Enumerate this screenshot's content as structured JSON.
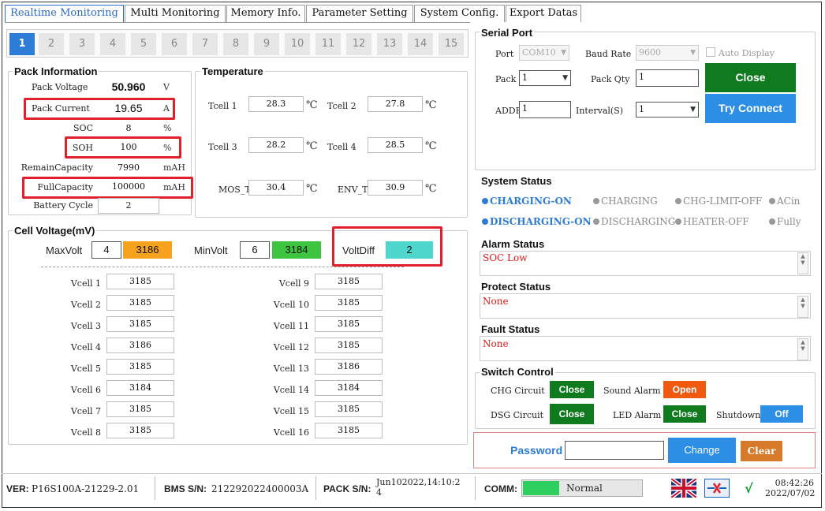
{
  "tabs": [
    "Realtime Monitoring",
    "Multi Monitoring",
    "Memory Info.",
    "Parameter Setting",
    "System Config.",
    "Export Datas"
  ],
  "pack_buttons": [
    "1",
    "2",
    "3",
    "4",
    "5",
    "6",
    "7",
    "8",
    "9",
    "10",
    "11",
    "12",
    "13",
    "14",
    "15"
  ],
  "pack_info": {
    "title": "Pack Information",
    "pack_voltage_label": "Pack Voltage",
    "pack_voltage": "50.960",
    "pack_voltage_unit": "V",
    "pack_current_label": "Pack Current",
    "pack_current": "19.65",
    "pack_current_unit": "A",
    "soc_label": "SOC",
    "soc": "8",
    "soc_unit": "%",
    "soh_label": "SOH",
    "soh": "100",
    "soh_unit": "%",
    "remain_label": "RemainCapacity",
    "remain": "7990",
    "remain_unit": "mAH",
    "full_label": "FullCapacity",
    "full": "100000",
    "full_unit": "mAH",
    "cycle_label": "Battery Cycle",
    "cycle": "2"
  },
  "temperature": {
    "title": "Temperature",
    "unit": "℃",
    "tcell1_label": "Tcell 1",
    "tcell1": "28.3",
    "tcell2_label": "Tcell 2",
    "tcell2": "27.8",
    "tcell3_label": "Tcell 3",
    "tcell3": "28.2",
    "tcell4_label": "Tcell 4",
    "tcell4": "28.5",
    "mos_label": "MOS_T",
    "mos": "30.4",
    "env_label": "ENV_T",
    "env": "30.9"
  },
  "cell_voltage": {
    "title": "Cell Voltage(mV)",
    "max_label": "MaxVolt",
    "max_index": "4",
    "max_value": "3186",
    "min_label": "MinVolt",
    "min_index": "6",
    "min_value": "3184",
    "diff_label": "VoltDiff",
    "diff_value": "2",
    "cells": [
      {
        "label": "Vcell 1",
        "value": "3185"
      },
      {
        "label": "Vcell 2",
        "value": "3185"
      },
      {
        "label": "Vcell 3",
        "value": "3185"
      },
      {
        "label": "Vcell 4",
        "value": "3186"
      },
      {
        "label": "Vcell 5",
        "value": "3185"
      },
      {
        "label": "Vcell 6",
        "value": "3184"
      },
      {
        "label": "Vcell 7",
        "value": "3185"
      },
      {
        "label": "Vcell 8",
        "value": "3185"
      },
      {
        "label": "Vcell 9",
        "value": "3185"
      },
      {
        "label": "Vcell 10",
        "value": "3185"
      },
      {
        "label": "Vcell 11",
        "value": "3185"
      },
      {
        "label": "Vcell 12",
        "value": "3185"
      },
      {
        "label": "Vcell 13",
        "value": "3186"
      },
      {
        "label": "Vcell 14",
        "value": "3184"
      },
      {
        "label": "Vcell 15",
        "value": "3185"
      },
      {
        "label": "Vcell 16",
        "value": "3185"
      }
    ]
  },
  "serial": {
    "title": "Serial Port",
    "port_label": "Port",
    "port": "COM10",
    "baud_label": "Baud Rate",
    "baud": "9600",
    "auto_display": "Auto Display",
    "pack_label": "Pack",
    "pack": "1",
    "packqty_label": "Pack Qty",
    "packqty": "1",
    "addr_label": "ADDR",
    "addr": "1",
    "interval_label": "Interval(S)",
    "interval": "1",
    "close_btn": "Close",
    "try_btn": "Try Connect"
  },
  "system_status": {
    "title": "System Status",
    "items": [
      "CHARGING-ON",
      "CHARGING",
      "CHG-LIMIT-OFF",
      "ACin",
      "DISCHARGING-ON",
      "DISCHARGING",
      "HEATER-OFF",
      "Fully"
    ]
  },
  "alarm": {
    "title": "Alarm Status",
    "text": "SOC Low"
  },
  "protect": {
    "title": "Protect Status",
    "text": "None"
  },
  "fault": {
    "title": "Fault Status",
    "text": "None"
  },
  "switch": {
    "title": "Switch Control",
    "chg_label": "CHG Circuit",
    "chg_btn": "Close",
    "sound_label": "Sound Alarm",
    "sound_btn": "Open",
    "dsg_label": "DSG Circuit",
    "dsg_btn": "Close",
    "led_label": "LED Alarm",
    "led_btn": "Close",
    "shutdown_label": "Shutdown",
    "shutdown_btn": "Off"
  },
  "password": {
    "label": "Password",
    "value": "",
    "change_btn": "Change",
    "clear_btn": "Clear"
  },
  "statusbar": {
    "ver_label": "VER:",
    "ver": "P16S100A-21229-2.01",
    "bms_label": "BMS S/N:",
    "bms": "212292022400003A",
    "pack_sn_label": "PACK S/N:",
    "pack_sn_line1": "Jun102022,14:10:2",
    "pack_sn_line2": "4",
    "comm_label": "COMM:",
    "comm": "Normal",
    "check": "√",
    "time": "08:42:26",
    "date": "2022/07/02"
  },
  "colors": {
    "accent_blue": "#2d7cd6",
    "green": "#0f7a1e",
    "orange": "#f08a1c",
    "highlight_red": "#e0202a",
    "max_orange": "#f5a21e",
    "min_green": "#3ec43e",
    "diff_teal": "#4fd6cc",
    "status_blue": "#2d7cd6",
    "status_gray": "#888888",
    "alarm_red": "#e01818"
  }
}
